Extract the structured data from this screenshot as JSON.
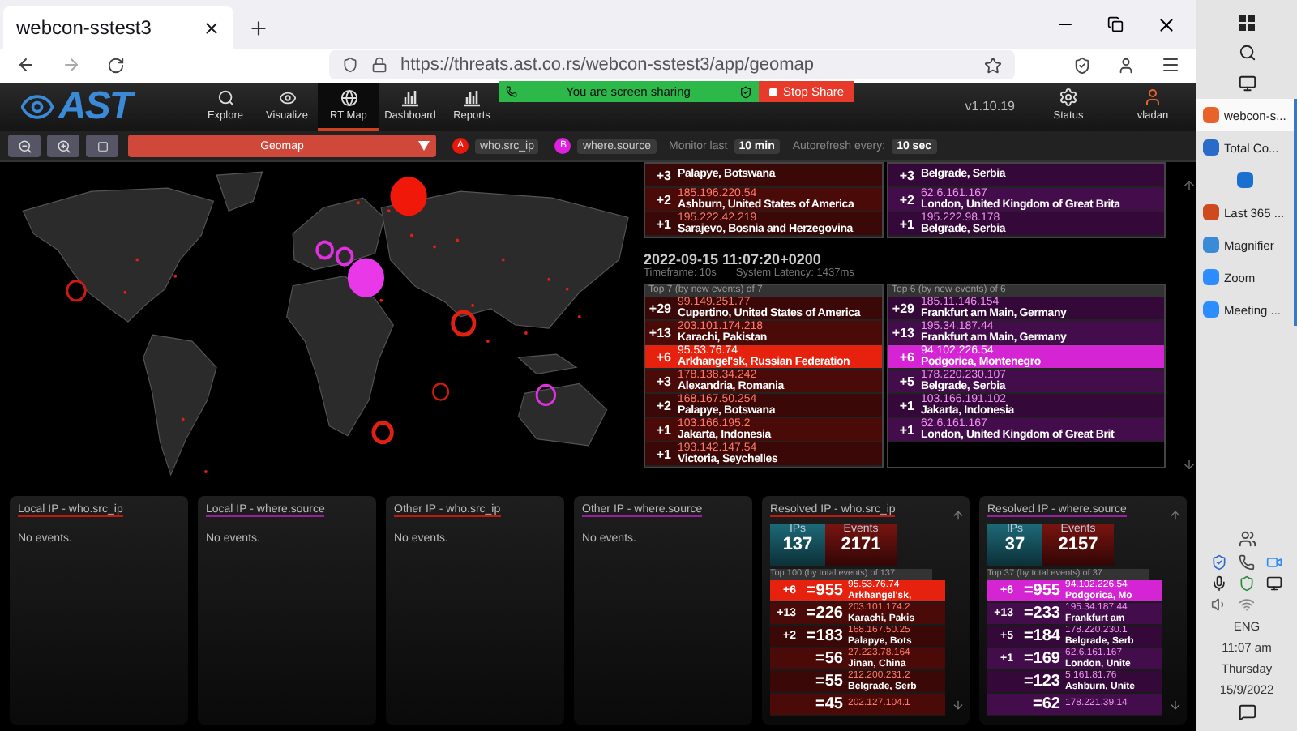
{
  "browser": {
    "tab_title": "webcon-sstest3",
    "url": "https://threats.ast.co.rs/webcon-sstest3/app/geomap"
  },
  "share_banner": {
    "message": "You are screen sharing",
    "stop_label": "Stop Share"
  },
  "app": {
    "logo": "AST",
    "version": "v1.10.19",
    "status_label": "Status",
    "user": "vladan",
    "nav": [
      {
        "label": "Explore",
        "selected": false
      },
      {
        "label": "Visualize",
        "selected": false
      },
      {
        "label": "RT Map",
        "selected": true
      },
      {
        "label": "Dashboard",
        "selected": false
      },
      {
        "label": "Reports",
        "selected": false
      }
    ]
  },
  "toolbar": {
    "view": "Geomap",
    "monitor_label": "Monitor last",
    "monitor_value": "10 min",
    "refresh_label": "Autorefresh every:",
    "refresh_value": "10 sec",
    "legend": [
      {
        "badge": "A",
        "field": "who.src_ip",
        "color": "#e8180c"
      },
      {
        "badge": "B",
        "field": "where.source",
        "color": "#e020e0"
      }
    ]
  },
  "snapshots": [
    {
      "tables": [
        {
          "kind": "who",
          "rows": [
            {
              "delta": "+3",
              "place": "Palapye, Botswana",
              "selected": false
            },
            {
              "delta": "+2",
              "ip": "185.196.220.54",
              "place": "Ashburn, United States of America",
              "selected": false
            },
            {
              "delta": "+1",
              "ip": "195.222.42.219",
              "place": "Sarajevo, Bosnia and Herzegovina",
              "selected": false
            }
          ]
        },
        {
          "kind": "where",
          "rows": [
            {
              "delta": "+3",
              "place": "Belgrade, Serbia",
              "selected": false
            },
            {
              "delta": "+2",
              "ip": "62.6.161.167",
              "place": "London, United Kingdom of Great Brita",
              "selected": false
            },
            {
              "delta": "+1",
              "ip": "195.222.98.178",
              "place": "Belgrade, Serbia",
              "selected": false
            }
          ]
        }
      ]
    },
    {
      "timestamp": "2022-09-15 11:07:20+0200",
      "timeframe": "Timeframe: 10s",
      "latency": "System Latency: 1437ms",
      "tables": [
        {
          "kind": "who",
          "caption": "Top 7 (by new events) of 7",
          "rows": [
            {
              "delta": "+29",
              "ip": "99.149.251.77",
              "place": "Cupertino, United States of America",
              "selected": false
            },
            {
              "delta": "+13",
              "ip": "203.101.174.218",
              "place": "Karachi, Pakistan",
              "selected": false
            },
            {
              "delta": "+6",
              "ip": "95.53.76.74",
              "place": "Arkhangel'sk, Russian Federation",
              "selected": true
            },
            {
              "delta": "+3",
              "ip": "178.138.34.242",
              "place": "Alexandria, Romania",
              "selected": false
            },
            {
              "delta": "+2",
              "ip": "168.167.50.254",
              "place": "Palapye, Botswana",
              "selected": false
            },
            {
              "delta": "+1",
              "ip": "103.166.195.2",
              "place": "Jakarta, Indonesia",
              "selected": false
            },
            {
              "delta": "+1",
              "ip": "193.142.147.54",
              "place": "Victoria, Seychelles",
              "selected": false
            }
          ]
        },
        {
          "kind": "where",
          "caption": "Top 6 (by new events) of 6",
          "rows": [
            {
              "delta": "+29",
              "ip": "185.11.146.154",
              "place": "Frankfurt am Main, Germany",
              "selected": false
            },
            {
              "delta": "+13",
              "ip": "195.34.187.44",
              "place": "Frankfurt am Main, Germany",
              "selected": false
            },
            {
              "delta": "+6",
              "ip": "94.102.226.54",
              "place": "Podgorica, Montenegro",
              "selected": true
            },
            {
              "delta": "+5",
              "ip": "178.220.230.107",
              "place": "Belgrade, Serbia",
              "selected": false
            },
            {
              "delta": "+1",
              "ip": "103.166.191.102",
              "place": "Jakarta, Indonesia",
              "selected": false
            },
            {
              "delta": "+1",
              "ip": "62.6.161.167",
              "place": "London, United Kingdom of Great Brit",
              "selected": false
            }
          ]
        }
      ]
    }
  ],
  "panels": [
    {
      "kind": "empty",
      "color": "#c01a10",
      "title": "Local IP - who.src_ip",
      "message": "No events."
    },
    {
      "kind": "empty",
      "color": "#9a20a0",
      "title": "Local IP - where.source",
      "message": "No events."
    },
    {
      "kind": "empty",
      "color": "#c01a10",
      "title": "Other IP - who.src_ip",
      "message": "No events."
    },
    {
      "kind": "empty",
      "color": "#9a20a0",
      "title": "Other IP - where.source",
      "message": "No events."
    },
    {
      "kind": "resolved",
      "color": "#c01a10",
      "title": "Resolved IP - who.src_ip",
      "ips_label": "IPs",
      "ips": "137",
      "events_label": "Events",
      "events": "2171",
      "table": {
        "kind": "who",
        "caption": "Top 100 (by total events) of 137",
        "rows": [
          {
            "delta": "+6",
            "total": "=955",
            "ip": "95.53.76.74",
            "place": "Arkhangel'sk,",
            "selected": true
          },
          {
            "delta": "+13",
            "total": "=226",
            "ip": "203.101.174.2",
            "place": "Karachi, Pakis",
            "selected": false
          },
          {
            "delta": "+2",
            "total": "=183",
            "ip": "168.167.50.25",
            "place": "Palapye, Bots",
            "selected": false
          },
          {
            "total": "=56",
            "ip": "27.223.78.164",
            "place": "Jinan, China",
            "selected": false
          },
          {
            "total": "=55",
            "ip": "212.200.231.2",
            "place": "Belgrade, Serb",
            "selected": false
          },
          {
            "total": "=45",
            "ip": "202.127.104.1",
            "selected": false
          }
        ]
      }
    },
    {
      "kind": "resolved",
      "color": "#9a20a0",
      "title": "Resolved IP - where.source",
      "ips_label": "IPs",
      "ips": "37",
      "events_label": "Events",
      "events": "2157",
      "table": {
        "kind": "where",
        "caption": "Top 37 (by total events) of 37",
        "rows": [
          {
            "delta": "+6",
            "total": "=955",
            "ip": "94.102.226.54",
            "place": "Podgorica, Mo",
            "selected": true
          },
          {
            "delta": "+13",
            "total": "=233",
            "ip": "195.34.187.44",
            "place": "Frankfurt am",
            "selected": false
          },
          {
            "delta": "+5",
            "total": "=184",
            "ip": "178.220.230.1",
            "place": "Belgrade, Serb",
            "selected": false
          },
          {
            "delta": "+1",
            "total": "=169",
            "ip": "62.6.161.167",
            "place": "London, Unite",
            "selected": false
          },
          {
            "total": "=123",
            "ip": "5.161.81.76",
            "place": "Ashburn, Unite",
            "selected": false
          },
          {
            "total": "=62",
            "ip": "178.221.39.14",
            "selected": false
          }
        ]
      }
    }
  ],
  "taskbar": {
    "apps": [
      {
        "label": "webcon-s...",
        "selected": true
      },
      {
        "label": "Total Co...",
        "selected": false
      },
      {
        "selected": false
      },
      {
        "label": "Last 365 ...",
        "selected": false
      },
      {
        "label": "Magnifier",
        "selected": false
      },
      {
        "label": "Zoom",
        "selected": false
      },
      {
        "label": "Meeting ...",
        "selected": false
      }
    ],
    "language": "ENG",
    "time": "11:07 am",
    "day": "Thursday",
    "date": "15/9/2022"
  }
}
